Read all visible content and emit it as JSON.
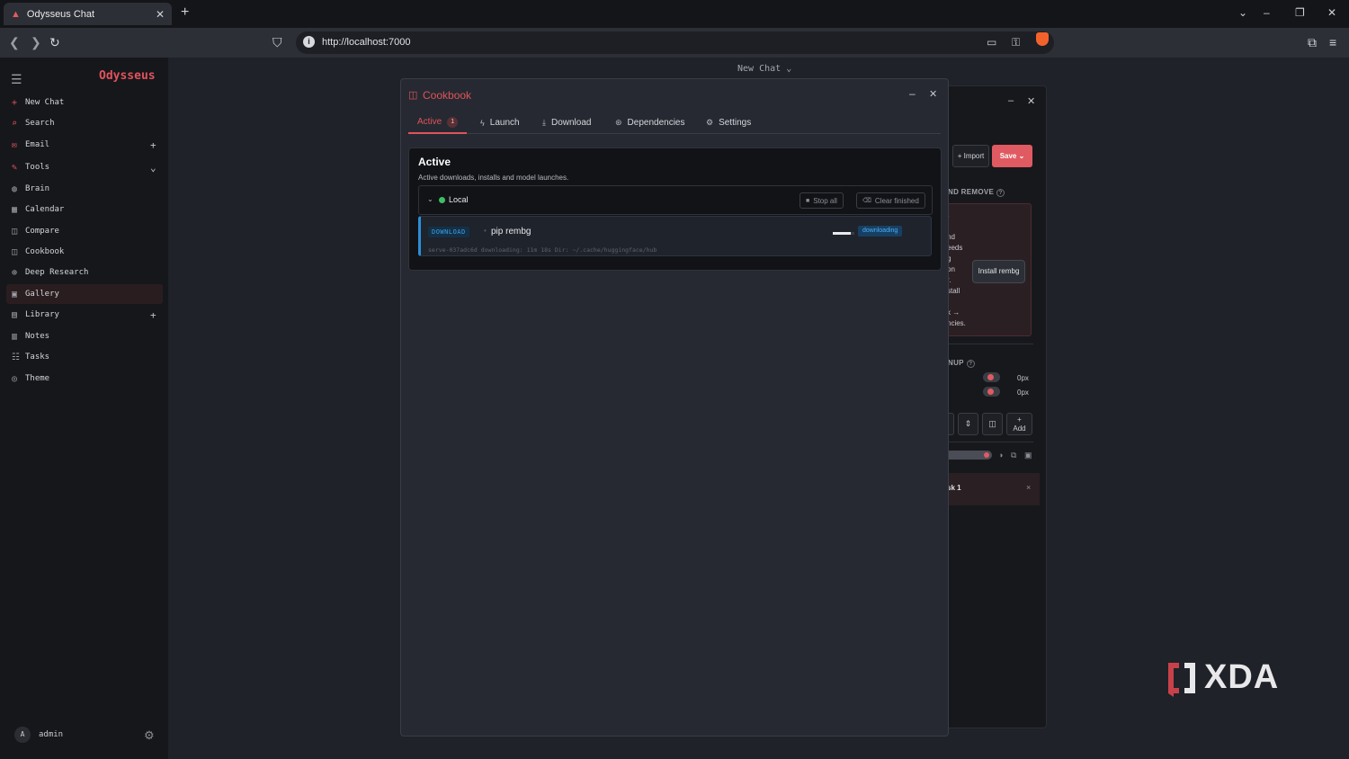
{
  "browser": {
    "tab_title": "Odysseus Chat",
    "new_tab": "+",
    "close_tab": "✕",
    "url": "http://localhost:7000"
  },
  "sidebar": {
    "brand": "Odysseus",
    "items": [
      {
        "label": "New Chat",
        "icon": "plus-icon",
        "glyph": "+"
      },
      {
        "label": "Search",
        "icon": "search-icon",
        "glyph": "⌕"
      },
      {
        "label": "Email",
        "icon": "mail-icon",
        "glyph": "✉"
      },
      {
        "label": "Tools",
        "icon": "wrench-icon",
        "glyph": "✎"
      },
      {
        "label": "Brain",
        "icon": "brain-icon",
        "glyph": "◍"
      },
      {
        "label": "Calendar",
        "icon": "calendar-icon",
        "glyph": "▦"
      },
      {
        "label": "Compare",
        "icon": "compare-icon",
        "glyph": "◫"
      },
      {
        "label": "Cookbook",
        "icon": "book-icon",
        "glyph": "◫"
      },
      {
        "label": "Deep Research",
        "icon": "research-icon",
        "glyph": "⊕"
      },
      {
        "label": "Gallery",
        "icon": "image-icon",
        "glyph": "▣"
      },
      {
        "label": "Library",
        "icon": "library-icon",
        "glyph": "▤"
      },
      {
        "label": "Notes",
        "icon": "note-icon",
        "glyph": "▥"
      },
      {
        "label": "Tasks",
        "icon": "tasks-icon",
        "glyph": "☷"
      },
      {
        "label": "Theme",
        "icon": "palette-icon",
        "glyph": "◎"
      }
    ],
    "user": {
      "initial": "A",
      "name": "admin"
    }
  },
  "header": {
    "new_chat": "New Chat"
  },
  "background_panel": {
    "import": "+ Import",
    "save": "Save",
    "section1": "ND REMOVE",
    "box_lines": [
      "t",
      "",
      "nd",
      "eeds",
      "g",
      "on",
      "r.",
      "stall",
      "",
      "",
      "k →",
      "ncies."
    ],
    "install_button": "Install rembg",
    "section2": "NUP",
    "px1": "0px",
    "px2": "0px",
    "add": "Add",
    "task": "sk 1"
  },
  "cookbook": {
    "title": "Cookbook",
    "tabs": [
      {
        "label": "Active",
        "badge": "1"
      },
      {
        "label": "Launch"
      },
      {
        "label": "Download"
      },
      {
        "label": "Dependencies"
      },
      {
        "label": "Settings"
      }
    ],
    "card": {
      "title": "Active",
      "subtitle": "Active downloads, installs and model launches.",
      "group": "Local",
      "stop_all": "Stop all",
      "clear_finished": "Clear finished",
      "job": {
        "type": "DOWNLOAD",
        "name": "pip rembg",
        "meta": "serve-037adc6d   downloading: 11m 18s   Dir: ~/.cache/huggingface/hub",
        "status": "downloading",
        "progress": 0.85
      }
    }
  },
  "watermark": "XDA",
  "colors": {
    "accent": "#e0535b",
    "info": "#2b8fd6",
    "ok": "#3fbf62"
  }
}
